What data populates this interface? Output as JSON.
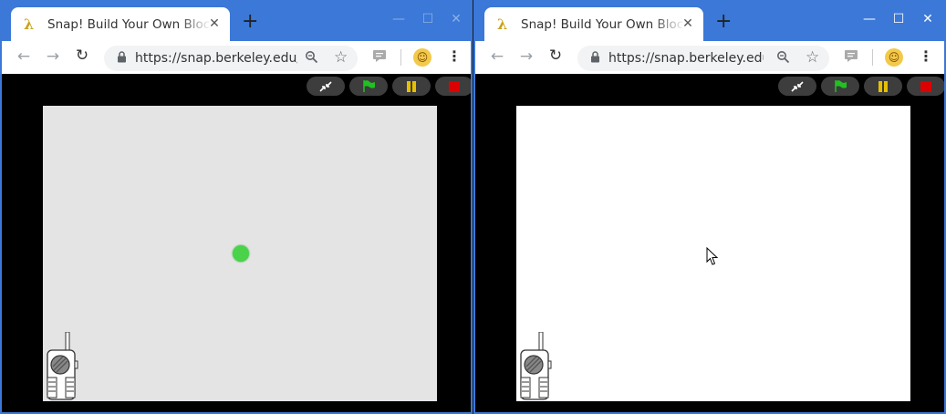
{
  "left_window": {
    "tab": {
      "title": "Snap! Build Your Own Blocks",
      "favicon": "λ"
    },
    "new_tab": "+",
    "controls": {
      "minimize": "—",
      "maximize": "☐",
      "close": "✕"
    },
    "omnibox": {
      "url": "https://snap.berkeley.edu/snapsource/snap.html"
    },
    "stage": {
      "background": "#e4e4e4",
      "dot_color": "#49d24a"
    }
  },
  "right_window": {
    "tab": {
      "title": "Snap! Build Your Own Blocks",
      "favicon": "λ"
    },
    "new_tab": "+",
    "controls": {
      "minimize": "—",
      "maximize": "☐",
      "close": "✕"
    },
    "omnibox": {
      "url": "https://snap.berkeley.edu/snapsource/snap.html"
    },
    "stage": {
      "background": "#ffffff"
    }
  },
  "colors": {
    "titlebar": "#3b78d8",
    "flag_green": "#22c022",
    "pause_yellow": "#e6c000",
    "stop_red": "#dd0000"
  },
  "icons": {
    "back": "←",
    "forward": "→",
    "reload": "↻",
    "lock": "🔒",
    "zoom": "⚲",
    "star": "☆",
    "chat": "▤",
    "avatar": "☺",
    "menu": "⋮"
  }
}
